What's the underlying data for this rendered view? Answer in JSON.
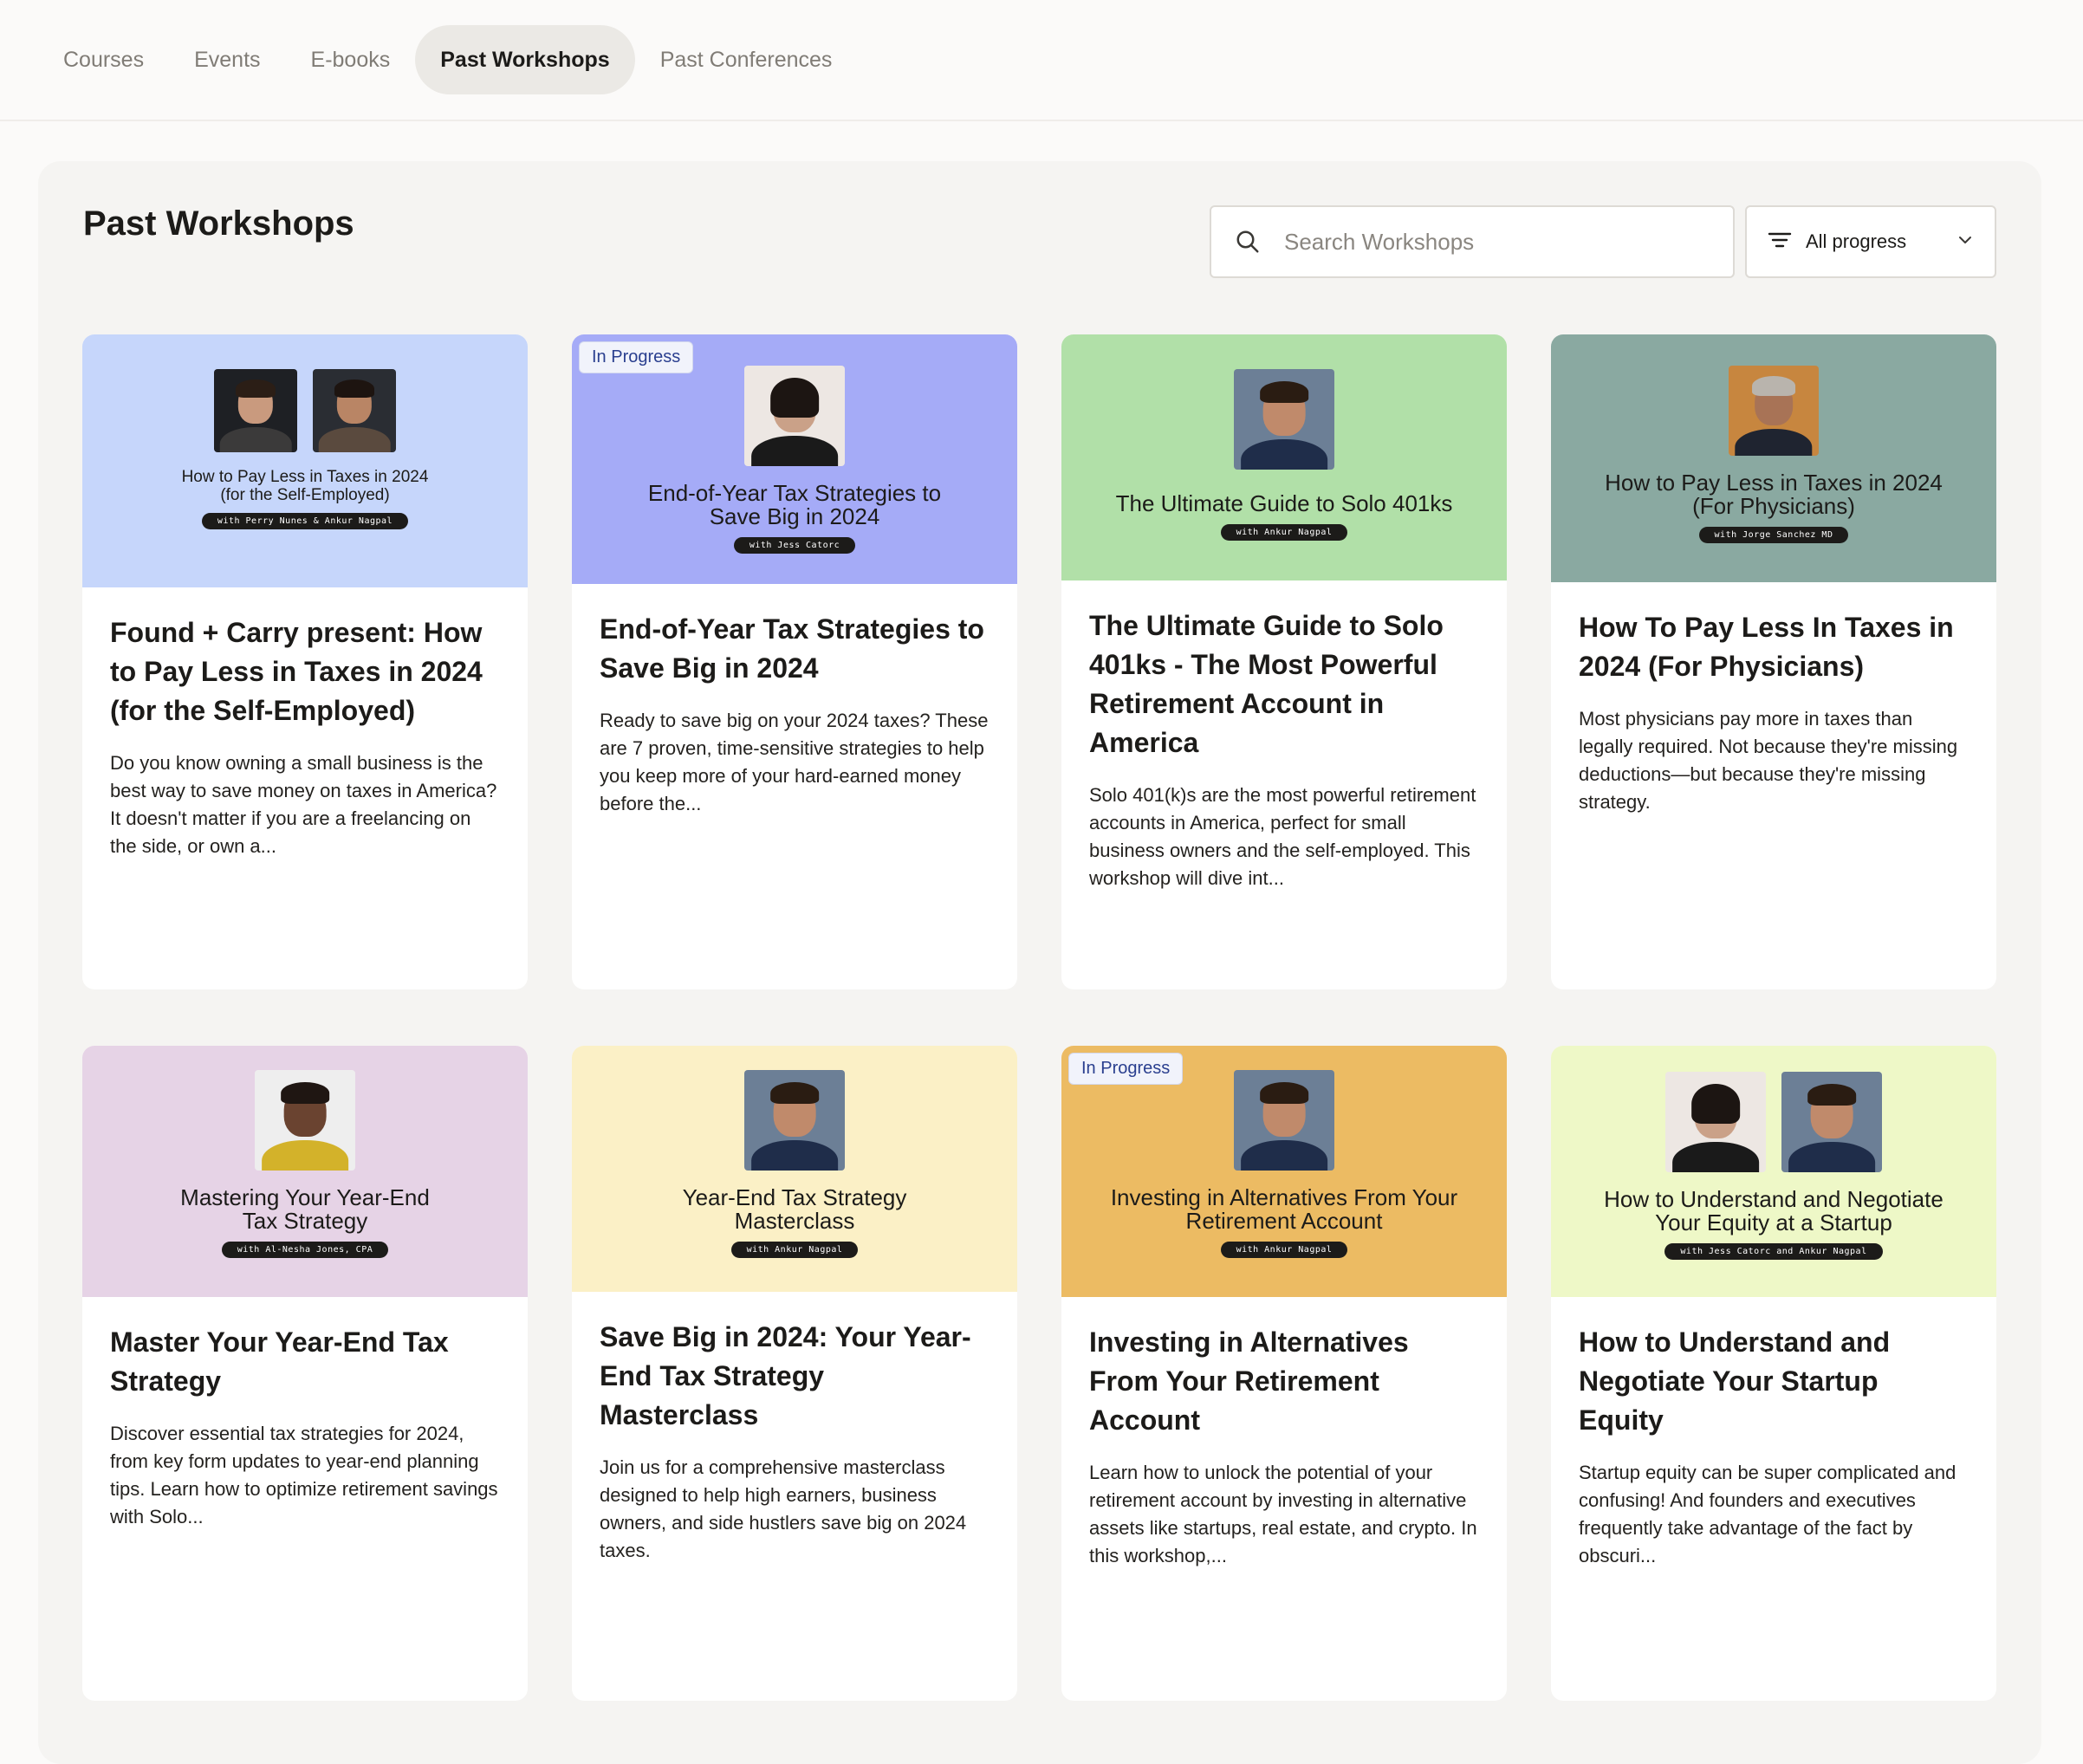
{
  "nav": {
    "tabs": [
      {
        "label": "Courses"
      },
      {
        "label": "Events"
      },
      {
        "label": "E-books"
      },
      {
        "label": "Past Workshops"
      },
      {
        "label": "Past Conferences"
      }
    ]
  },
  "page": {
    "title": "Past Workshops",
    "search_placeholder": "Search Workshops",
    "filter_label": "All progress"
  },
  "colors": {
    "card1": "#c6d6fb",
    "card2": "#a5abf7",
    "card3": "#b1e0a8",
    "card4": "#8aa9a1",
    "card5": "#e6d3e6",
    "card6": "#fbf0c6",
    "card7": "#ecbb63",
    "card8": "#eef8c7"
  },
  "cards": [
    {
      "badge": "",
      "thumb_title": "How to Pay Less in Taxes in 2024 (for the Self-Employed)",
      "thumb_host": "with Perry Nunes & Ankur Nagpal",
      "title": "Found + Carry present: How to Pay Less in Taxes in 2024 (for the Self-Employed)",
      "description": "Do you know owning a small business is the best way to save money on taxes in America?It doesn't matter if you are a freelancing on the side, or own a..."
    },
    {
      "badge": "In Progress",
      "thumb_title": "End-of-Year Tax Strategies to Save Big in 2024",
      "thumb_host": "with Jess Catorc",
      "title": "End-of-Year Tax Strategies to Save Big in 2024",
      "description": "Ready to save big on your 2024 taxes? These are 7 proven, time-sensitive strategies to help you keep more of your hard-earned money before the..."
    },
    {
      "badge": "",
      "thumb_title": "The Ultimate Guide to Solo 401ks",
      "thumb_host": "with Ankur Nagpal",
      "title": "The Ultimate Guide to Solo 401ks - The Most Powerful Retirement Account in America",
      "description": "Solo 401(k)s are the most powerful retirement accounts in America, perfect for small business owners and the self-employed. This workshop will dive int..."
    },
    {
      "badge": "",
      "thumb_title": "How to Pay Less in Taxes in 2024 (For Physicians)",
      "thumb_host": "with Jorge Sanchez MD",
      "title": "How To Pay Less In Taxes in 2024 (For Physicians)",
      "description": "Most physicians pay more in taxes than legally required. Not because they're missing deductions—but because they're missing strategy."
    },
    {
      "badge": "",
      "thumb_title": "Mastering Your Year-End Tax Strategy",
      "thumb_host": "with Al-Nesha Jones, CPA",
      "title": "Master Your Year-End Tax Strategy",
      "description": "Discover essential tax strategies for 2024, from key form updates to year-end planning tips. Learn how to optimize retirement savings with Solo..."
    },
    {
      "badge": "",
      "thumb_title": "Year-End Tax Strategy Masterclass",
      "thumb_host": "with Ankur Nagpal",
      "title": "Save Big in 2024: Your Year-End Tax Strategy Masterclass",
      "description": "Join us for a comprehensive masterclass designed to help high earners, business owners, and side hustlers save big on 2024 taxes."
    },
    {
      "badge": "In Progress",
      "thumb_title": "Investing in Alternatives From Your Retirement Account",
      "thumb_host": "with Ankur Nagpal",
      "title": "Investing in Alternatives From Your Retirement Account",
      "description": "Learn how to unlock the potential of your retirement account by investing in alternative assets like startups, real estate, and crypto. In this workshop,..."
    },
    {
      "badge": "",
      "thumb_title": "How to Understand and Negotiate Your Equity at a Startup",
      "thumb_host": "with Jess Catorc and Ankur Nagpal",
      "title": "How to Understand and Negotiate Your Startup Equity",
      "description": "Startup equity can be super complicated and confusing! And founders and executives frequently take advantage of the fact by obscuri..."
    }
  ]
}
